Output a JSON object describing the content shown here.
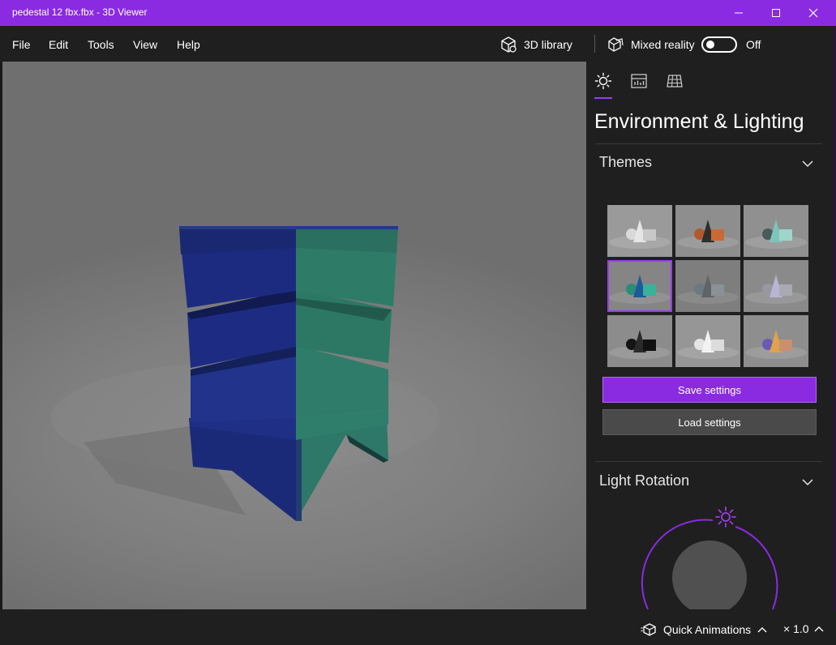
{
  "window": {
    "title": "pedestal 12 fbx.fbx - 3D Viewer",
    "accent_color": "#8a2be2",
    "controls": [
      "minimize-icon",
      "maximize-icon",
      "close-icon"
    ]
  },
  "menu": {
    "items": [
      "File",
      "Edit",
      "Tools",
      "View",
      "Help"
    ],
    "library_label": "3D library",
    "library_icon": "cube-icon",
    "mixed_reality_label": "Mixed reality",
    "mixed_reality_icon": "mixed-reality-icon",
    "mixed_reality_state": "Off"
  },
  "viewport": {
    "model_colors": {
      "left_face": "#1c2a7a",
      "right_face": "#2e7a6a",
      "background": "#7f7f7f"
    }
  },
  "panel": {
    "tabs": [
      "sun-icon",
      "stats-icon",
      "grid-icon"
    ],
    "active_tab": 0,
    "title": "Environment & Lighting",
    "themes_label": "Themes",
    "themes": [
      {
        "name": "theme-grey",
        "selected": false
      },
      {
        "name": "theme-orange",
        "selected": false
      },
      {
        "name": "theme-teal",
        "selected": false
      },
      {
        "name": "theme-green",
        "selected": true
      },
      {
        "name": "theme-slate",
        "selected": false
      },
      {
        "name": "theme-lavender",
        "selected": false
      },
      {
        "name": "theme-black",
        "selected": false
      },
      {
        "name": "theme-white",
        "selected": false
      },
      {
        "name": "theme-multicolor",
        "selected": false
      }
    ],
    "save_label": "Save settings",
    "load_label": "Load settings",
    "light_rotation_label": "Light Rotation"
  },
  "status": {
    "animations_label": "Quick Animations",
    "animations_icon": "animation-cube-icon",
    "speed_label": "× 1.0"
  }
}
